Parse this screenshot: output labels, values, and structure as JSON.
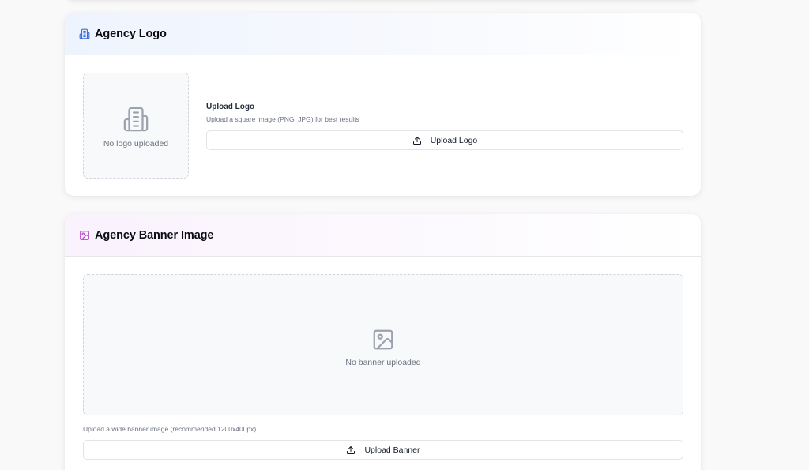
{
  "logo_section": {
    "title": "Agency Logo",
    "header_icon": "building-icon",
    "placeholder_icon": "building-icon",
    "placeholder_text": "No logo uploaded",
    "upload_title": "Upload Logo",
    "upload_hint": "Upload a square image (PNG, JPG) for best results",
    "button_label": "Upload Logo",
    "button_icon": "upload-icon",
    "accent_color": "#3b6fd8"
  },
  "banner_section": {
    "title": "Agency Banner Image",
    "header_icon": "image-icon",
    "placeholder_icon": "image-icon",
    "placeholder_text": "No banner uploaded",
    "upload_hint": "Upload a wide banner image (recommended 1200x400px)",
    "button_label": "Upload Banner",
    "button_icon": "upload-icon",
    "accent_color": "#b545c9"
  }
}
